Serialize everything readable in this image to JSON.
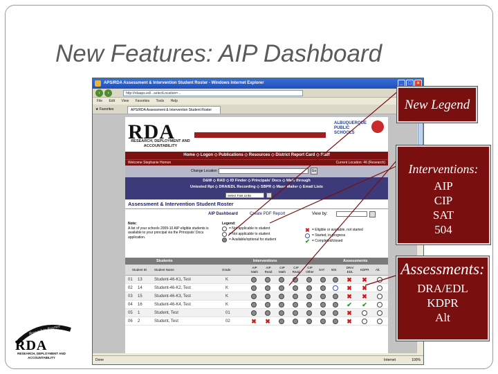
{
  "slide": {
    "title": "New Features: AIP Dashboard"
  },
  "browser": {
    "window_title": "APS/RDA Assessment & Intervention Student Roster - Windows Internet Explorer",
    "address": "http://rdaaps.ed/...selectLocation=...",
    "menu": [
      "File",
      "Edit",
      "View",
      "Favorites",
      "Tools",
      "Help"
    ],
    "favorites_label": "Favorites",
    "tab_label": "APS/RDA Assessment & Intervention Student Roster",
    "status_text": "Done",
    "zone_text": "Internet",
    "zoom_text": "100%"
  },
  "page": {
    "rda_logo": "RDA",
    "rda_subtitle": "RESEARCH, DEPLOYMENT AND ACCOUNTABILITY",
    "aps_name": "ALBUQUERQUE PUBLIC SCHOOLS",
    "nav1": "Home ◇ Logon ◇ Publications ◇ Resources ◇ District Report Card ◇ Staff",
    "welcome": "Welcome Stephanie Homon",
    "location": "Current Location: 46 (Research)",
    "change_location_label": "Change Location To:",
    "go_label": "Go",
    "nav2_line1": "D&W ◇ RAD ◇ ID Finder ◇ Principals' Docs ◇ Walk through",
    "nav2_line2": "Untested Rpt ◇ DRA/EDL Recording ◇ SBPR ◇ Mass Mailer ◇ Email Lists",
    "search_select": "Select Fast Links",
    "section_title": "Assessment & Intervention Student Roster",
    "aip_dashboard": "AIP Dashboard",
    "create_pdf": "Create PDF Report",
    "view_by": "View by:",
    "note_title": "Note:",
    "note_text": "A list of your schools 2009-10 AIP eligible students is available to your principal via the Principals' Docs application.",
    "legend_title": "Legend:",
    "legend_left": [
      {
        "marker": "strike",
        "label": "= Not applicable to student"
      },
      {
        "marker": "empty",
        "label": "= Not applicable to student"
      },
      {
        "marker": "gray",
        "label": "= Available/optional for student"
      }
    ],
    "legend_right": [
      {
        "marker": "x",
        "label": "= Eligible or available, not started"
      },
      {
        "marker": "blue",
        "label": "= Started, in-progress"
      },
      {
        "marker": "chk",
        "label": "= Completed/closed"
      }
    ],
    "group_headers": {
      "students": "Students",
      "interventions": "Interventions",
      "assessments": "Assessments"
    },
    "columns": {
      "student_id": "Student ID",
      "student_name": "Student Name",
      "grade": "Grade",
      "aip_math": "AIP Math",
      "aip_read": "AIP Read",
      "cip_math": "CIP Math",
      "cip_read": "CIP Read",
      "cip_other": "CIP Other",
      "sat": "SAT",
      "c504": "504",
      "dra": "DRA/ EDL",
      "kdpr": "KDPR",
      "alt": "Alt."
    },
    "students": [
      {
        "row": "01",
        "id": "13",
        "name": "Student-46-K1, Test",
        "grade": "K",
        "marks": [
          "gray",
          "gray",
          "gray",
          "gray",
          "gray",
          "gray",
          "gray",
          "x",
          "x",
          "empty"
        ]
      },
      {
        "row": "02",
        "id": "14",
        "name": "Student-46-K2, Test",
        "grade": "K",
        "marks": [
          "gray",
          "gray",
          "gray",
          "gray",
          "gray",
          "gray",
          "blue",
          "x",
          "x",
          "empty"
        ]
      },
      {
        "row": "03",
        "id": "15",
        "name": "Student-46-K3, Test",
        "grade": "K",
        "marks": [
          "gray",
          "gray",
          "gray",
          "gray",
          "gray",
          "gray",
          "gray",
          "x",
          "x",
          "empty"
        ]
      },
      {
        "row": "04",
        "id": "16",
        "name": "Student-46-K4, Test",
        "grade": "K",
        "marks": [
          "gray",
          "gray",
          "gray",
          "gray",
          "gray",
          "gray",
          "gray",
          "chk",
          "chk",
          "empty"
        ]
      },
      {
        "row": "05",
        "id": "1",
        "name": "Student, Test",
        "grade": "01",
        "marks": [
          "gray",
          "gray",
          "gray",
          "gray",
          "gray",
          "gray",
          "gray",
          "x",
          "empty",
          "empty"
        ]
      },
      {
        "row": "06",
        "id": "2",
        "name": "Student, Test",
        "grade": "02",
        "marks": [
          "x",
          "x",
          "gray",
          "gray",
          "gray",
          "gray",
          "gray",
          "x",
          "empty",
          "empty"
        ]
      }
    ]
  },
  "callouts": {
    "legend": "New Legend",
    "interventions_title": "Interventions:",
    "interventions_items": [
      "AIP",
      "CIP",
      "SAT",
      "504"
    ],
    "assessments_title": "Assessments:",
    "assessments_items": [
      "DRA/EDL",
      "KDPR",
      "Alt"
    ]
  },
  "footer_logo": {
    "tagline": "Research to Practice",
    "name": "RDA",
    "subtitle": "RESEARCH, DEPLOYMENT AND ACCOUNTABILITY"
  },
  "colors": {
    "callout_bg": "#7a0f0f",
    "nav_red": "#7a1212",
    "nav_blue": "#3c3a78",
    "eligible_x": "#d01818",
    "completed_check": "#1e9a1e",
    "in_progress_ring": "#2d4fc9"
  }
}
